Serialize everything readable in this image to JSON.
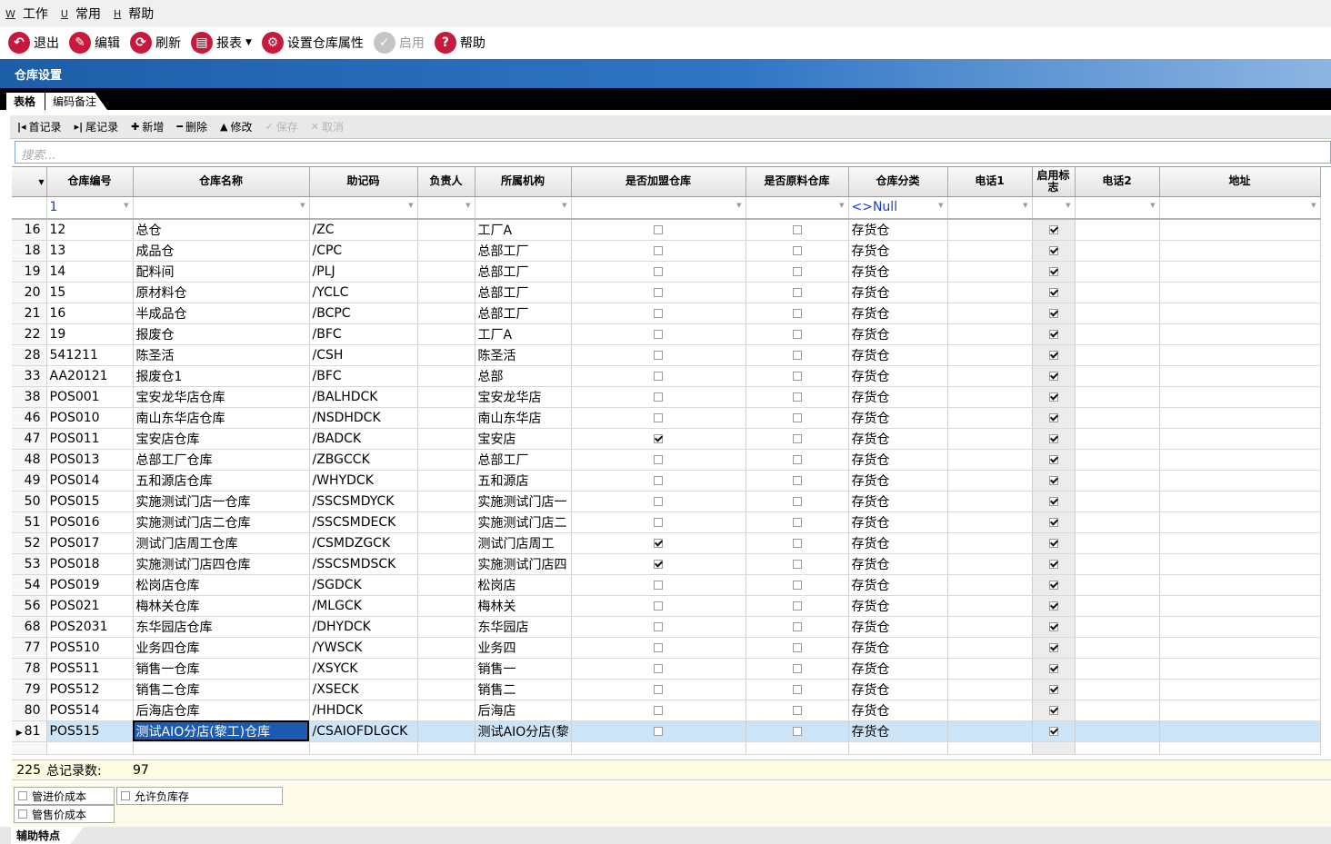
{
  "menu": [
    {
      "key": "W",
      "label": "工作"
    },
    {
      "key": "U",
      "label": "常用"
    },
    {
      "key": "H",
      "label": "帮助"
    }
  ],
  "toolbar": {
    "exit": "退出",
    "edit": "编辑",
    "refresh": "刷新",
    "report": "报表",
    "settings": "设置仓库属性",
    "enable": "启用",
    "help": "帮助"
  },
  "window_title": "仓库设置",
  "tabs": {
    "grid": "表格",
    "notes": "编码备注"
  },
  "nav": {
    "first": "首记录",
    "last": "尾记录",
    "add": "新增",
    "delete": "删除",
    "modify": "修改",
    "save": "保存",
    "cancel": "取消"
  },
  "search": {
    "placeholder": "搜索..."
  },
  "columns": [
    "仓库编号",
    "仓库名称",
    "助记码",
    "负责人",
    "所属机构",
    "是否加盟仓库",
    "是否原料仓库",
    "仓库分类",
    "电话1",
    "启用标志",
    "电话2",
    "地址"
  ],
  "filter": {
    "code": "1",
    "category": "<>Null"
  },
  "rows": [
    {
      "idx": "16",
      "code": "12",
      "name": "总仓",
      "mnemonic": "/ZC",
      "owner": "",
      "org": "工厂A",
      "franchise": false,
      "raw": false,
      "category": "存货仓",
      "tel1": "",
      "enabled": true,
      "tel2": "",
      "addr": ""
    },
    {
      "idx": "18",
      "code": "13",
      "name": "成品仓",
      "mnemonic": "/CPC",
      "owner": "",
      "org": "总部工厂",
      "franchise": false,
      "raw": false,
      "category": "存货仓",
      "tel1": "",
      "enabled": true,
      "tel2": "",
      "addr": ""
    },
    {
      "idx": "19",
      "code": "14",
      "name": "配料间",
      "mnemonic": "/PLJ",
      "owner": "",
      "org": "总部工厂",
      "franchise": false,
      "raw": false,
      "category": "存货仓",
      "tel1": "",
      "enabled": true,
      "tel2": "",
      "addr": ""
    },
    {
      "idx": "20",
      "code": "15",
      "name": "原材料仓",
      "mnemonic": "/YCLC",
      "owner": "",
      "org": "总部工厂",
      "franchise": false,
      "raw": false,
      "category": "存货仓",
      "tel1": "",
      "enabled": true,
      "tel2": "",
      "addr": ""
    },
    {
      "idx": "21",
      "code": "16",
      "name": "半成品仓",
      "mnemonic": "/BCPC",
      "owner": "",
      "org": "总部工厂",
      "franchise": false,
      "raw": false,
      "category": "存货仓",
      "tel1": "",
      "enabled": true,
      "tel2": "",
      "addr": ""
    },
    {
      "idx": "22",
      "code": "19",
      "name": "报废仓",
      "mnemonic": "/BFC",
      "owner": "",
      "org": "工厂A",
      "franchise": false,
      "raw": false,
      "category": "存货仓",
      "tel1": "",
      "enabled": true,
      "tel2": "",
      "addr": ""
    },
    {
      "idx": "28",
      "code": "541211",
      "name": "陈圣活",
      "mnemonic": "/CSH",
      "owner": "",
      "org": "陈圣活",
      "franchise": false,
      "raw": false,
      "category": "存货仓",
      "tel1": "",
      "enabled": true,
      "tel2": "",
      "addr": ""
    },
    {
      "idx": "33",
      "code": "AA20121",
      "name": "报废仓1",
      "mnemonic": "/BFC",
      "owner": "",
      "org": "总部",
      "franchise": false,
      "raw": false,
      "category": "存货仓",
      "tel1": "",
      "enabled": true,
      "tel2": "",
      "addr": ""
    },
    {
      "idx": "38",
      "code": "POS001",
      "name": "宝安龙华店仓库",
      "mnemonic": "/BALHDCK",
      "owner": "",
      "org": "宝安龙华店",
      "franchise": false,
      "raw": false,
      "category": "存货仓",
      "tel1": "",
      "enabled": true,
      "tel2": "",
      "addr": ""
    },
    {
      "idx": "46",
      "code": "POS010",
      "name": "南山东华店仓库",
      "mnemonic": "/NSDHDCK",
      "owner": "",
      "org": "南山东华店",
      "franchise": false,
      "raw": false,
      "category": "存货仓",
      "tel1": "",
      "enabled": true,
      "tel2": "",
      "addr": ""
    },
    {
      "idx": "47",
      "code": "POS011",
      "name": "宝安店仓库",
      "mnemonic": "/BADCK",
      "owner": "",
      "org": "宝安店",
      "franchise": true,
      "raw": false,
      "category": "存货仓",
      "tel1": "",
      "enabled": true,
      "tel2": "",
      "addr": ""
    },
    {
      "idx": "48",
      "code": "POS013",
      "name": "总部工厂仓库",
      "mnemonic": "/ZBGCCK",
      "owner": "",
      "org": "总部工厂",
      "franchise": false,
      "raw": false,
      "category": "存货仓",
      "tel1": "",
      "enabled": true,
      "tel2": "",
      "addr": ""
    },
    {
      "idx": "49",
      "code": "POS014",
      "name": "五和源店仓库",
      "mnemonic": "/WHYDCK",
      "owner": "",
      "org": "五和源店",
      "franchise": false,
      "raw": false,
      "category": "存货仓",
      "tel1": "",
      "enabled": true,
      "tel2": "",
      "addr": ""
    },
    {
      "idx": "50",
      "code": "POS015",
      "name": "实施测试门店一仓库",
      "mnemonic": "/SSCSMDYCK",
      "owner": "",
      "org": "实施测试门店一",
      "franchise": false,
      "raw": false,
      "category": "存货仓",
      "tel1": "",
      "enabled": true,
      "tel2": "",
      "addr": ""
    },
    {
      "idx": "51",
      "code": "POS016",
      "name": "实施测试门店二仓库",
      "mnemonic": "/SSCSMDECK",
      "owner": "",
      "org": "实施测试门店二",
      "franchise": false,
      "raw": false,
      "category": "存货仓",
      "tel1": "",
      "enabled": true,
      "tel2": "",
      "addr": ""
    },
    {
      "idx": "52",
      "code": "POS017",
      "name": "测试门店周工仓库",
      "mnemonic": "/CSMDZGCK",
      "owner": "",
      "org": "测试门店周工",
      "franchise": true,
      "raw": false,
      "category": "存货仓",
      "tel1": "",
      "enabled": true,
      "tel2": "",
      "addr": ""
    },
    {
      "idx": "53",
      "code": "POS018",
      "name": "实施测试门店四仓库",
      "mnemonic": "/SSCSMDSCK",
      "owner": "",
      "org": "实施测试门店四",
      "franchise": true,
      "raw": false,
      "category": "存货仓",
      "tel1": "",
      "enabled": true,
      "tel2": "",
      "addr": ""
    },
    {
      "idx": "54",
      "code": "POS019",
      "name": "松岗店仓库",
      "mnemonic": "/SGDCK",
      "owner": "",
      "org": "松岗店",
      "franchise": false,
      "raw": false,
      "category": "存货仓",
      "tel1": "",
      "enabled": true,
      "tel2": "",
      "addr": ""
    },
    {
      "idx": "56",
      "code": "POS021",
      "name": "梅林关仓库",
      "mnemonic": "/MLGCK",
      "owner": "",
      "org": "梅林关",
      "franchise": false,
      "raw": false,
      "category": "存货仓",
      "tel1": "",
      "enabled": true,
      "tel2": "",
      "addr": ""
    },
    {
      "idx": "68",
      "code": "POS2031",
      "name": "东华园店仓库",
      "mnemonic": "/DHYDCK",
      "owner": "",
      "org": "东华园店",
      "franchise": false,
      "raw": false,
      "category": "存货仓",
      "tel1": "",
      "enabled": true,
      "tel2": "",
      "addr": ""
    },
    {
      "idx": "77",
      "code": "POS510",
      "name": "业务四仓库",
      "mnemonic": "/YWSCK",
      "owner": "",
      "org": "业务四",
      "franchise": false,
      "raw": false,
      "category": "存货仓",
      "tel1": "",
      "enabled": true,
      "tel2": "",
      "addr": ""
    },
    {
      "idx": "78",
      "code": "POS511",
      "name": "销售一仓库",
      "mnemonic": "/XSYCK",
      "owner": "",
      "org": "销售一",
      "franchise": false,
      "raw": false,
      "category": "存货仓",
      "tel1": "",
      "enabled": true,
      "tel2": "",
      "addr": ""
    },
    {
      "idx": "79",
      "code": "POS512",
      "name": "销售二仓库",
      "mnemonic": "/XSECK",
      "owner": "",
      "org": "销售二",
      "franchise": false,
      "raw": false,
      "category": "存货仓",
      "tel1": "",
      "enabled": true,
      "tel2": "",
      "addr": ""
    },
    {
      "idx": "80",
      "code": "POS514",
      "name": "后海店仓库",
      "mnemonic": "/HHDCK",
      "owner": "",
      "org": "后海店",
      "franchise": false,
      "raw": false,
      "category": "存货仓",
      "tel1": "",
      "enabled": true,
      "tel2": "",
      "addr": ""
    },
    {
      "idx": "81",
      "code": "POS515",
      "name": "测试AIO分店(黎工)仓库",
      "mnemonic": "/CSAIOFDLGCK",
      "owner": "",
      "org": "测试AIO分店(黎",
      "franchise": false,
      "raw": false,
      "category": "存货仓",
      "tel1": "",
      "enabled": true,
      "tel2": "",
      "addr": "",
      "selected": true
    }
  ],
  "footer": {
    "index": "225",
    "label": "总记录数:",
    "count": "97"
  },
  "options": {
    "purchase_cost": "管进价成本",
    "sale_cost": "管售价成本",
    "allow_negative": "允许负库存"
  },
  "bottom_tab": "辅助特点",
  "colors": {
    "accent": "#1d5ea8",
    "icon_red": "#c8193c",
    "selection": "#cde4f7"
  }
}
